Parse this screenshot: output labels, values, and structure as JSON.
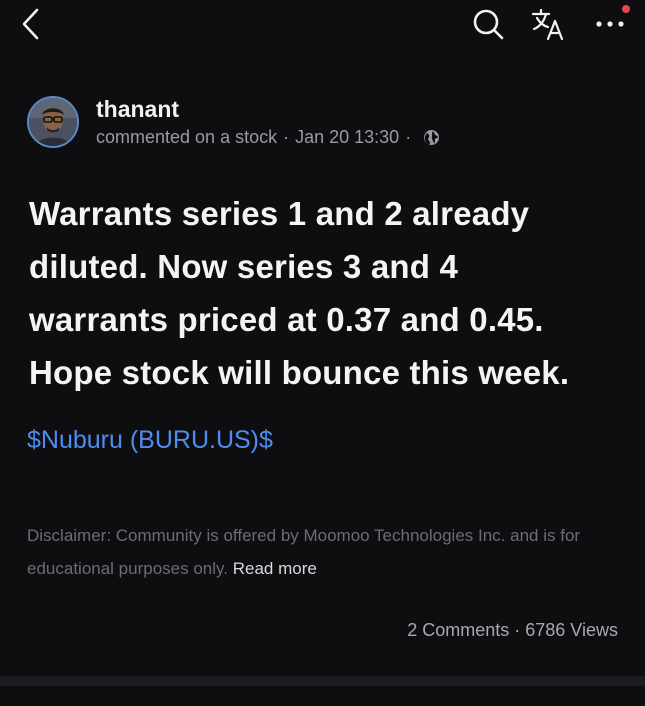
{
  "topbar": {
    "back_icon": "back-chevron-icon",
    "search_icon": "search-icon",
    "translate_icon": "translate-icon",
    "more_icon": "more-dots-icon",
    "notification_color": "#e5484d"
  },
  "post": {
    "username": "thanant",
    "action": "commented on a stock",
    "date": "Jan 20 13:30",
    "separator": "·",
    "body": "Warrants series 1 and 2 already\ndiluted. Now series 3 and 4\nwarrants priced at 0.37 and 0.45.\nHope stock will bounce this week.",
    "stock_tag": "$Nuburu (BURU.US)$",
    "stock_tag_color": "#4d8df0"
  },
  "disclaimer": {
    "text": "Disclaimer: Community is offered by Moomoo Technologies Inc. and is for educational purposes only.",
    "read_more": "Read more"
  },
  "stats": {
    "comments": "2 Comments",
    "separator": "·",
    "views": "6786 Views"
  }
}
